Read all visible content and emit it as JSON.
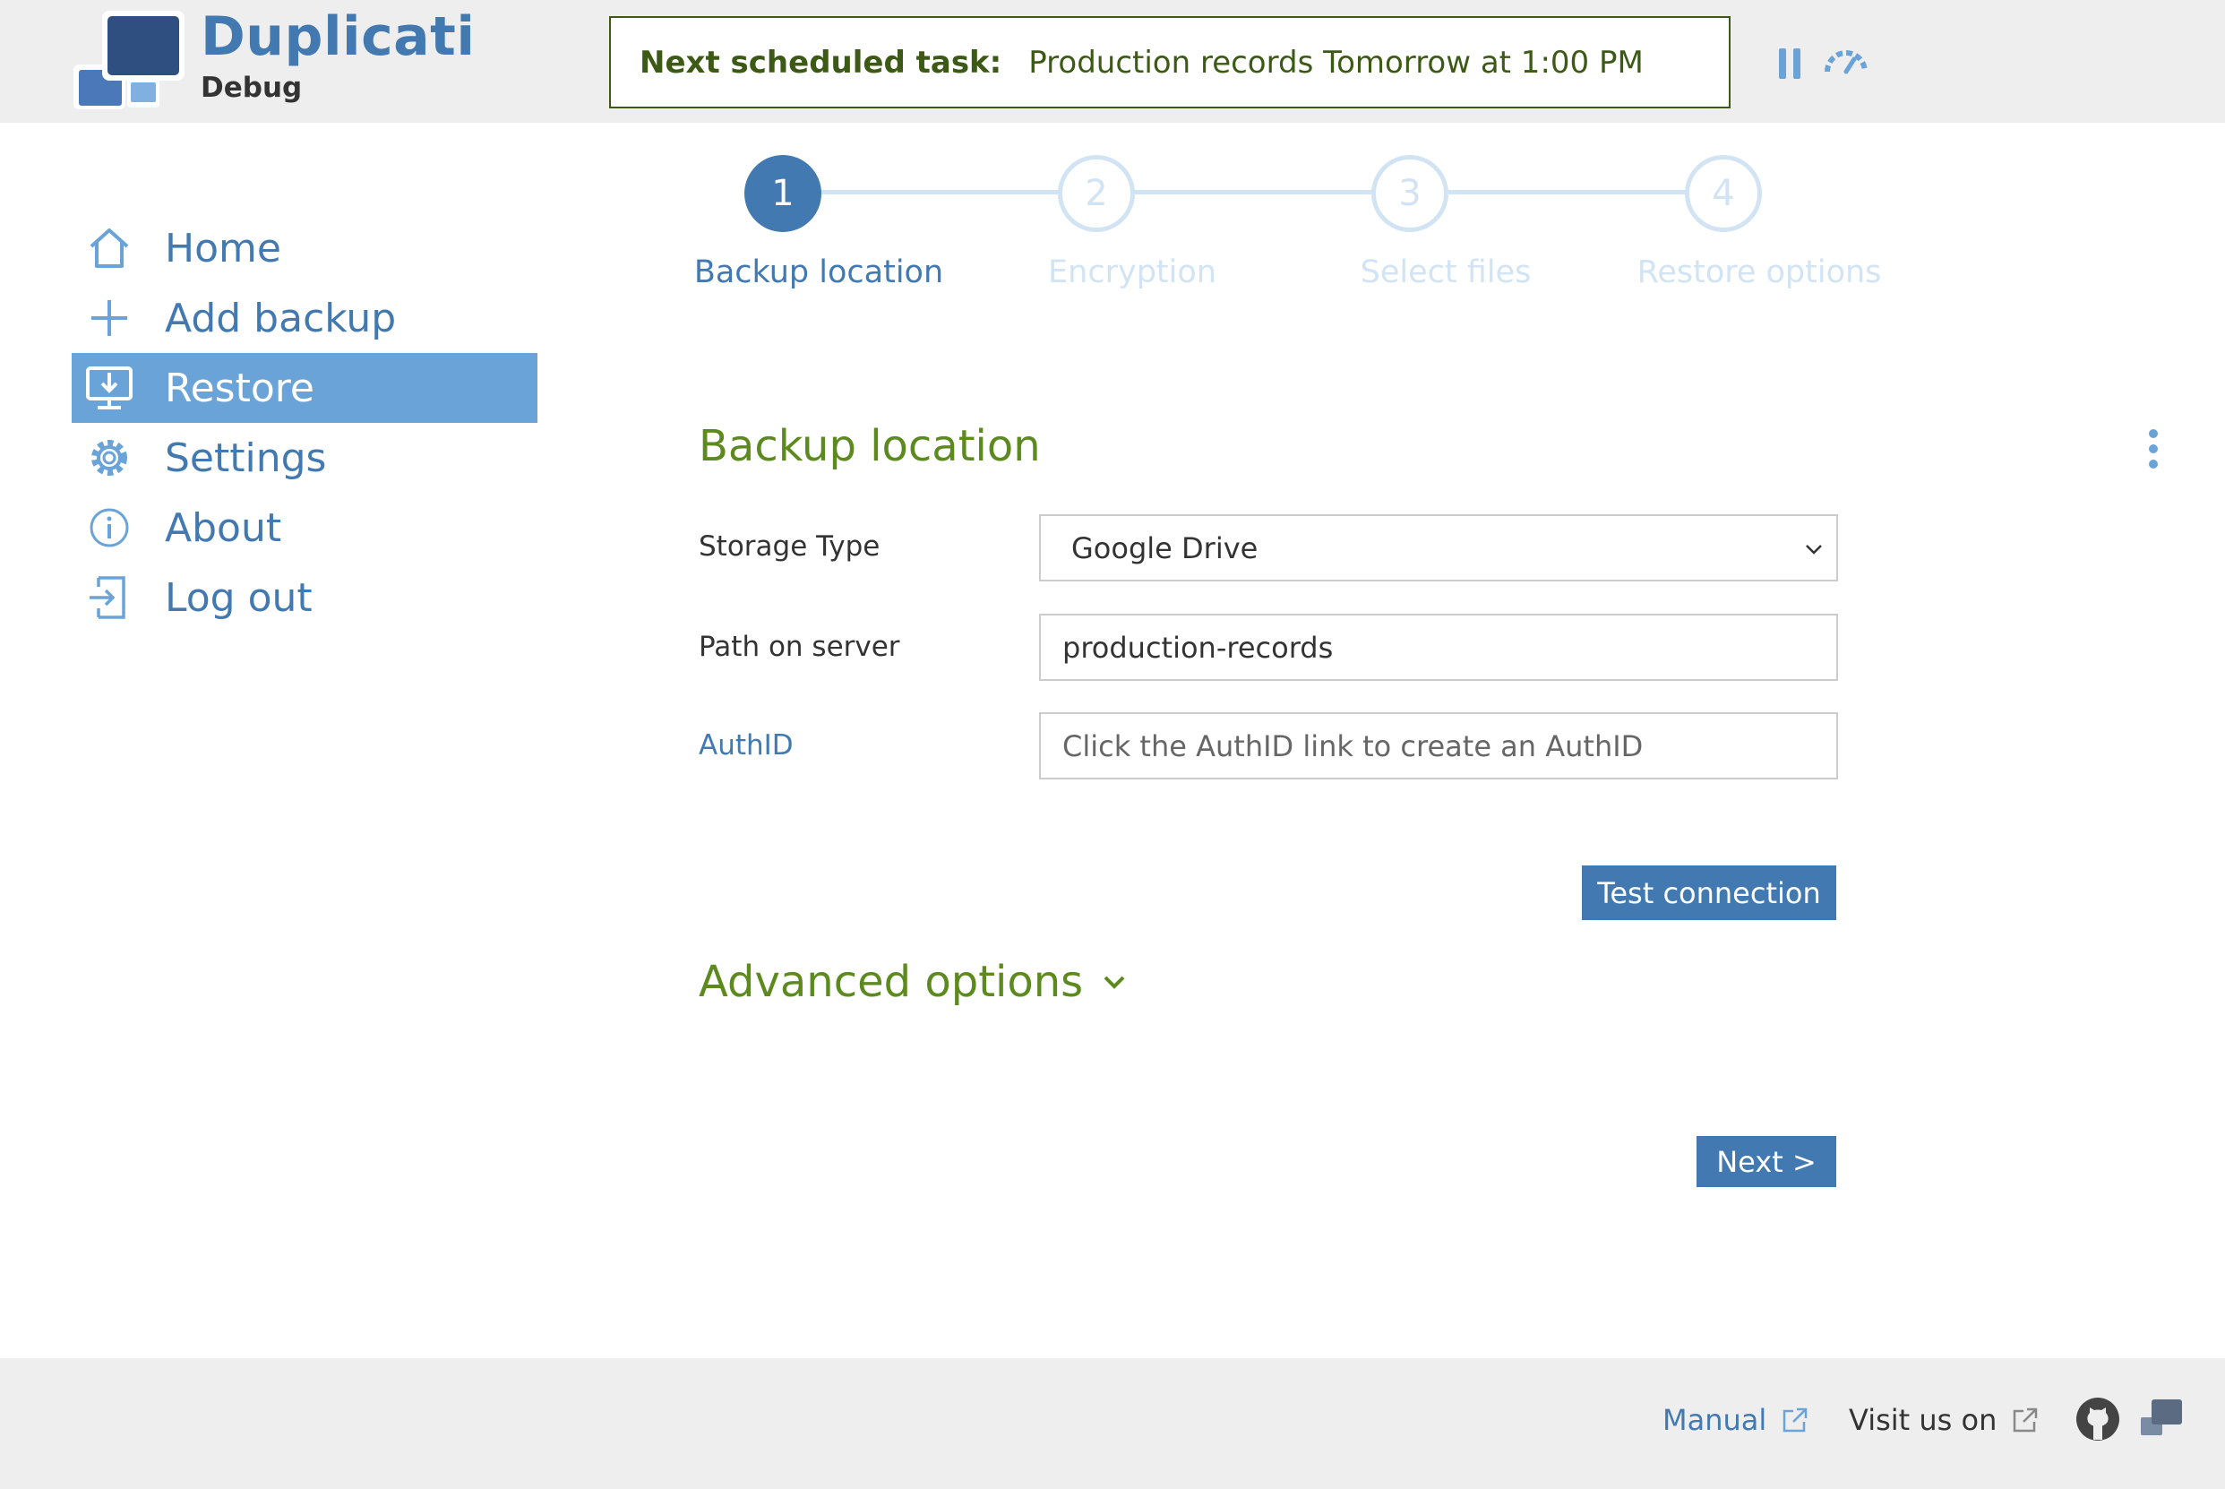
{
  "app": {
    "name": "Duplicati",
    "subtitle": "Debug"
  },
  "header": {
    "next_task_label": "Next scheduled task:",
    "next_task_value": "Production records Tomorrow at 1:00 PM",
    "pause_icon": "pause-icon",
    "throttle_icon": "throttle-icon"
  },
  "sidebar": {
    "items": [
      {
        "label": "Home",
        "icon": "home-icon",
        "active": false
      },
      {
        "label": "Add backup",
        "icon": "plus-icon",
        "active": false
      },
      {
        "label": "Restore",
        "icon": "restore-monitor-icon",
        "active": true
      },
      {
        "label": "Settings",
        "icon": "gear-icon",
        "active": false
      },
      {
        "label": "About",
        "icon": "info-icon",
        "active": false
      },
      {
        "label": "Log out",
        "icon": "logout-icon",
        "active": false
      }
    ]
  },
  "stepper": {
    "steps": [
      {
        "number": "1",
        "label": "Backup location",
        "active": true
      },
      {
        "number": "2",
        "label": "Encryption",
        "active": false
      },
      {
        "number": "3",
        "label": "Select files",
        "active": false
      },
      {
        "number": "4",
        "label": "Restore options",
        "active": false
      }
    ]
  },
  "form": {
    "title": "Backup location",
    "storage_type_label": "Storage Type",
    "storage_type_value": "Google Drive",
    "path_label": "Path on server",
    "path_value": "production-records",
    "authid_label": "AuthID",
    "authid_placeholder": "Click the AuthID link to create an AuthID",
    "test_button": "Test connection",
    "advanced_label": "Advanced options",
    "next_button": "Next >"
  },
  "footer": {
    "manual": "Manual",
    "visit": "Visit us on",
    "github_icon": "github-icon",
    "duplicati_icon": "duplicati-logo-icon"
  },
  "colors": {
    "accent": "#4279b0",
    "sidebar_active": "#6aa3d8",
    "section_green": "#5d8a1f",
    "step_inactive": "#d2e4f3"
  }
}
